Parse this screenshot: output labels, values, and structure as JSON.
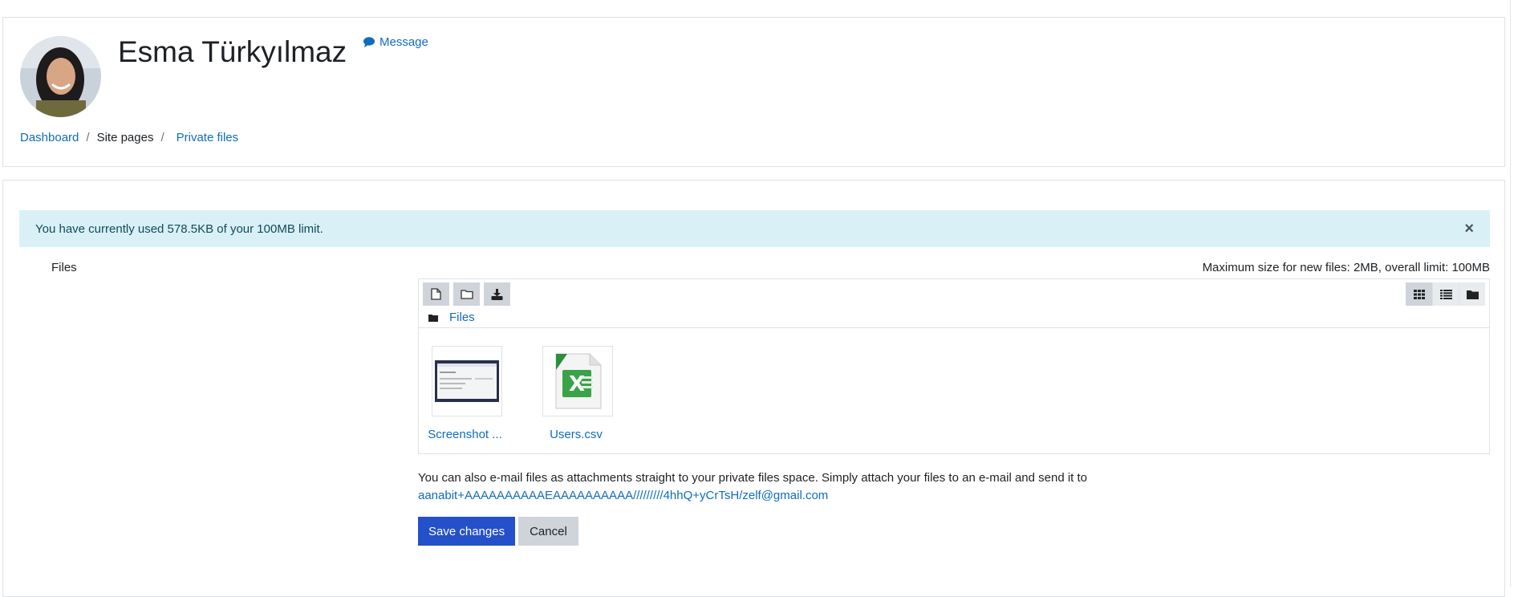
{
  "header": {
    "user_name": "Esma Türkyılmaz",
    "message_label": "Message",
    "breadcrumb": {
      "dashboard": "Dashboard",
      "site_pages": "Site pages",
      "private_files": "Private files"
    }
  },
  "alert": {
    "text": "You have currently used 578.5KB of your 100MB limit.",
    "close_glyph": "×"
  },
  "files_section": {
    "label": "Files",
    "max_size": "Maximum size for new files: 2MB, overall limit: 100MB",
    "path_label": "Files",
    "toolbar_icons": [
      "add-file-icon",
      "create-folder-icon",
      "download-icon"
    ],
    "view_icons": [
      "grid-view-icon",
      "list-view-icon",
      "tree-view-icon"
    ],
    "files": [
      {
        "name": "Screenshot ...",
        "icon": "image-thumbnail-icon"
      },
      {
        "name": "Users.csv",
        "icon": "spreadsheet-file-icon"
      }
    ]
  },
  "email_note": {
    "text": "You can also e-mail files as attachments straight to your private files space. Simply attach your files to an e-mail and send it to",
    "address": "aanabit+AAAAAAAAAAEAAAAAAAAAA/////////4hhQ+yCrTsH/zelf@gmail.com"
  },
  "actions": {
    "save_label": "Save changes",
    "cancel_label": "Cancel"
  },
  "colors": {
    "link": "#0f6cbf",
    "alert_bg": "#d9f0f7",
    "primary": "#2450c9"
  }
}
